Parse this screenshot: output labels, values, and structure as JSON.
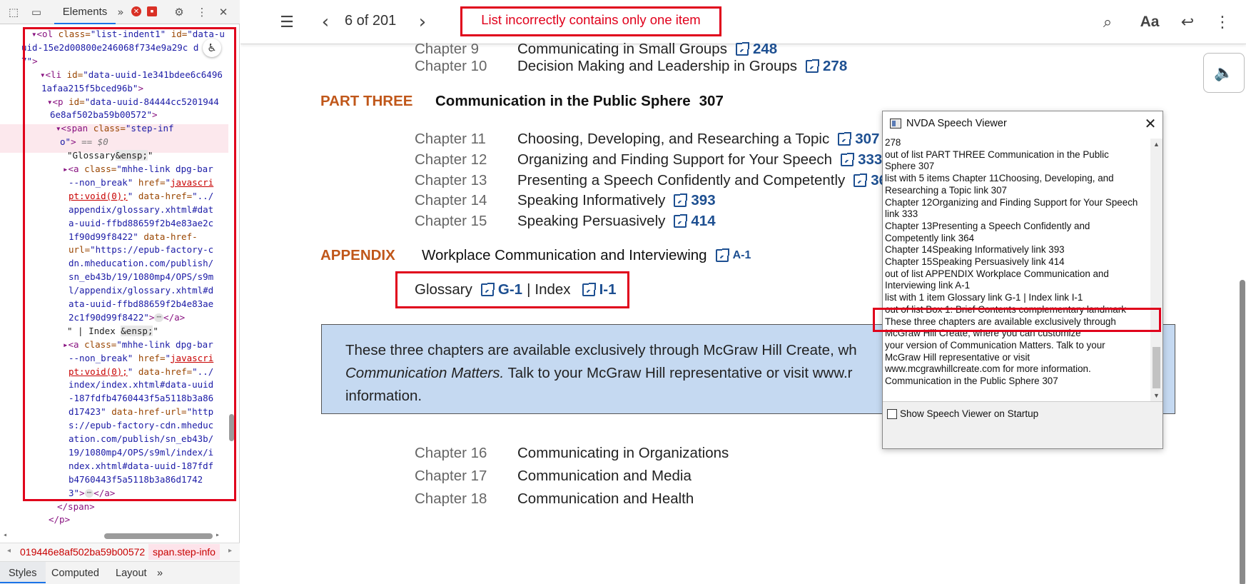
{
  "devtools": {
    "tab_elements": "Elements",
    "more_tabs": "»",
    "error_badge": "✕",
    "issue_badge": "▪",
    "tree_lines": [
      [
        {
          "c": "t-tag",
          "t": "▾<ol "
        },
        {
          "c": "t-attr",
          "t": "class="
        },
        {
          "c": "t-val",
          "t": "\"list-indent1\" "
        },
        {
          "c": "t-attr",
          "t": "id="
        },
        {
          "c": "t-val",
          "t": "\"data-u"
        }
      ],
      [
        {
          "c": "t-val",
          "t": "uid-15e2d00800e246068f734e9a29c d"
        }
      ],
      [
        {
          "c": "t-val",
          "t": "7\""
        },
        {
          "c": "t-tag",
          "t": ">"
        }
      ],
      [
        {
          "c": "t-tag",
          "t": "▾<li "
        },
        {
          "c": "t-attr",
          "t": "id="
        },
        {
          "c": "t-val",
          "t": "\"data-uuid-1e341bdee6c6496"
        }
      ],
      [
        {
          "c": "t-val",
          "t": "1afaa215f5bced96b\""
        },
        {
          "c": "t-tag",
          "t": ">"
        }
      ],
      [
        {
          "c": "t-tag",
          "t": "▾<p "
        },
        {
          "c": "t-attr",
          "t": "id="
        },
        {
          "c": "t-val",
          "t": "\"data-uuid-84444cc5201944"
        }
      ],
      [
        {
          "c": "t-val",
          "t": "6e8af502ba59b00572\""
        },
        {
          "c": "t-tag",
          "t": ">"
        }
      ],
      [
        {
          "c": "t-tag",
          "t": "▾<span "
        },
        {
          "c": "t-attr",
          "t": "class="
        },
        {
          "c": "t-val",
          "t": "\"step-inf"
        }
      ],
      [
        {
          "c": "t-val",
          "t": "o\""
        },
        {
          "c": "t-tag",
          "t": ">"
        },
        {
          "c": "t-dim",
          "t": " == $0"
        }
      ],
      [
        {
          "c": "t-text",
          "t": "\"Glossary"
        },
        {
          "c": "t-ent",
          "t": "&ensp;"
        },
        {
          "c": "t-text",
          "t": "\""
        }
      ],
      [
        {
          "c": "t-tag",
          "t": "▸<a "
        },
        {
          "c": "t-attr",
          "t": "class="
        },
        {
          "c": "t-val",
          "t": "\"mhhe-link dpg-bar"
        }
      ],
      [
        {
          "c": "t-val",
          "t": "--non_break\" "
        },
        {
          "c": "t-attr",
          "t": "href="
        },
        {
          "c": "t-val",
          "t": "\""
        },
        {
          "c": "t-linkred",
          "t": "javascri"
        }
      ],
      [
        {
          "c": "t-linkred",
          "t": "pt:void(0);"
        },
        {
          "c": "t-val",
          "t": "\" "
        },
        {
          "c": "t-attr",
          "t": "data-href="
        },
        {
          "c": "t-val",
          "t": "\"../"
        }
      ],
      [
        {
          "c": "t-val",
          "t": "appendix/glossary.xhtml#dat"
        }
      ],
      [
        {
          "c": "t-val",
          "t": "a-uuid-ffbd88659f2b4e83ae2c"
        }
      ],
      [
        {
          "c": "t-val",
          "t": "1f90d99f8422\" "
        },
        {
          "c": "t-attr",
          "t": "data-href-"
        }
      ],
      [
        {
          "c": "t-attr",
          "t": "url="
        },
        {
          "c": "t-val",
          "t": "\"https://epub-factory-c"
        }
      ],
      [
        {
          "c": "t-val",
          "t": "dn.mheducation.com/publish/"
        }
      ],
      [
        {
          "c": "t-val",
          "t": "sn_eb43b/19/1080mp4/OPS/s9m"
        }
      ],
      [
        {
          "c": "t-val",
          "t": "l/appendix/glossary.xhtml#d"
        }
      ],
      [
        {
          "c": "t-val",
          "t": "ata-uuid-ffbd88659f2b4e83ae"
        }
      ],
      [
        {
          "c": "t-val",
          "t": "2c1f90d99f8422\""
        },
        {
          "c": "t-tag",
          "t": ">"
        },
        {
          "c": "ellip",
          "t": "⋯"
        },
        {
          "c": "t-tag",
          "t": "</a>"
        }
      ],
      [
        {
          "c": "t-text",
          "t": "\" | Index "
        },
        {
          "c": "t-ent",
          "t": "&ensp;"
        },
        {
          "c": "t-text",
          "t": "\""
        }
      ],
      [
        {
          "c": "t-tag",
          "t": "▸<a "
        },
        {
          "c": "t-attr",
          "t": "class="
        },
        {
          "c": "t-val",
          "t": "\"mhhe-link dpg-bar"
        }
      ],
      [
        {
          "c": "t-val",
          "t": "--non_break\" "
        },
        {
          "c": "t-attr",
          "t": "href="
        },
        {
          "c": "t-val",
          "t": "\""
        },
        {
          "c": "t-linkred",
          "t": "javascri"
        }
      ],
      [
        {
          "c": "t-linkred",
          "t": "pt:void(0);"
        },
        {
          "c": "t-val",
          "t": "\" "
        },
        {
          "c": "t-attr",
          "t": "data-href="
        },
        {
          "c": "t-val",
          "t": "\"../"
        }
      ],
      [
        {
          "c": "t-val",
          "t": "index/index.xhtml#data-uuid"
        }
      ],
      [
        {
          "c": "t-val",
          "t": "-187fdfb4760443f5a5118b3a86"
        }
      ],
      [
        {
          "c": "t-val",
          "t": "d17423\" "
        },
        {
          "c": "t-attr",
          "t": "data-href-url="
        },
        {
          "c": "t-val",
          "t": "\"http"
        }
      ],
      [
        {
          "c": "t-val",
          "t": "s://epub-factory-cdn.mheduc"
        }
      ],
      [
        {
          "c": "t-val",
          "t": "ation.com/publish/sn_eb43b/"
        }
      ],
      [
        {
          "c": "t-val",
          "t": "19/1080mp4/OPS/s9ml/index/i"
        }
      ],
      [
        {
          "c": "t-val",
          "t": "ndex.xhtml#data-uuid-187fdf"
        }
      ],
      [
        {
          "c": "t-val",
          "t": "b4760443f5a5118b3a86d1742"
        }
      ],
      [
        {
          "c": "t-val",
          "t": "3\""
        },
        {
          "c": "t-tag",
          "t": ">"
        },
        {
          "c": "ellip",
          "t": "⋯"
        },
        {
          "c": "t-tag",
          "t": "</a>"
        }
      ],
      [
        {
          "c": "t-tag",
          "t": "</span>"
        }
      ],
      [
        {
          "c": "t-tag",
          "t": "</p>"
        }
      ]
    ],
    "breadcrumb_1": "019446e8af502ba59b00572",
    "breadcrumb_2": "span.step-info",
    "subtab_styles": "Styles",
    "subtab_computed": "Computed",
    "subtab_layout": "Layout",
    "subtab_more": "»"
  },
  "reader": {
    "page_counter": "6 of 201",
    "annotation_top": "List incorrectly contains only one item",
    "font_button": "Aa",
    "chapters_top": [
      {
        "num": "Chapter 9",
        "title": "Communicating in Small Groups",
        "page": "248"
      },
      {
        "num": "Chapter 10",
        "title": "Decision Making and Leadership in Groups",
        "page": "278"
      }
    ],
    "part_three": {
      "label": "PART THREE",
      "title": "Communication in the Public Sphere",
      "page": "307"
    },
    "chapters_mid": [
      {
        "num": "Chapter 11",
        "title": "Choosing, Developing, and Researching a Topic",
        "page": "307"
      },
      {
        "num": "Chapter 12",
        "title": "Organizing and Finding Support for Your Speech",
        "page": "333"
      },
      {
        "num": "Chapter 13",
        "title": "Presenting a Speech Confidently and Competently",
        "page": "364"
      },
      {
        "num": "Chapter 14",
        "title": "Speaking Informatively",
        "page": "393"
      },
      {
        "num": "Chapter 15",
        "title": "Speaking Persuasively",
        "page": "414"
      }
    ],
    "appendix": {
      "label": "APPENDIX",
      "title": "Workplace Communication and Interviewing",
      "page": "A-1"
    },
    "glossary": {
      "label": "Glossary",
      "page": "G-1",
      "sep": "|",
      "index_label": "Index",
      "index_page": "I-1"
    },
    "box": {
      "line1": "These three chapters are available exclusively through McGraw Hill Create, wh",
      "line2_italic": "Communication Matters.",
      "line2_rest": " Talk to your McGraw Hill representative or visit www.r",
      "line3": "information."
    },
    "chapters_bottom": [
      {
        "num": "Chapter 16",
        "title": "Communicating in Organizations"
      },
      {
        "num": "Chapter 17",
        "title": "Communication and Media"
      },
      {
        "num": "Chapter 18",
        "title": "Communication and Health"
      }
    ]
  },
  "nvda": {
    "title": "NVDA Speech Viewer",
    "lines": [
      "278",
      "out of list  PART THREE  Communication in the Public",
      "Sphere  307",
      "list  with 5 items  Chapter 11Choosing, Developing, and",
      "Researching a Topic    link    307",
      "Chapter 12Organizing and Finding Support for Your Speech",
      "link    333",
      "Chapter 13Presenting a Speech Confidently and",
      "Competently    link    364",
      "Chapter 14Speaking Informatively    link    393",
      "Chapter 15Speaking Persuasively    link    414",
      "out of list  APPENDIX  Workplace Communication and",
      "Interviewing    link    A-1",
      "list  with 1 item  Glossary    link    G-1    | Index     link    I-1",
      "out of list  Box 1: Brief Contents  complementary landmark",
      "These three chapters are available exclusively through",
      "McGraw Hill Create, where you can customize",
      "your version of   Communication Matters.   Talk to your",
      "McGraw Hill representative or visit",
      "www.mcgrawhillcreate.com for more information.",
      "Communication in the Public Sphere  307"
    ],
    "checkbox_label": "Show Speech Viewer on Startup"
  },
  "colors": {
    "annotation_red": "#e0001b",
    "part_orange": "#c0571a",
    "link_blue": "#1d4f91",
    "box_bg": "#c5d9f1"
  }
}
